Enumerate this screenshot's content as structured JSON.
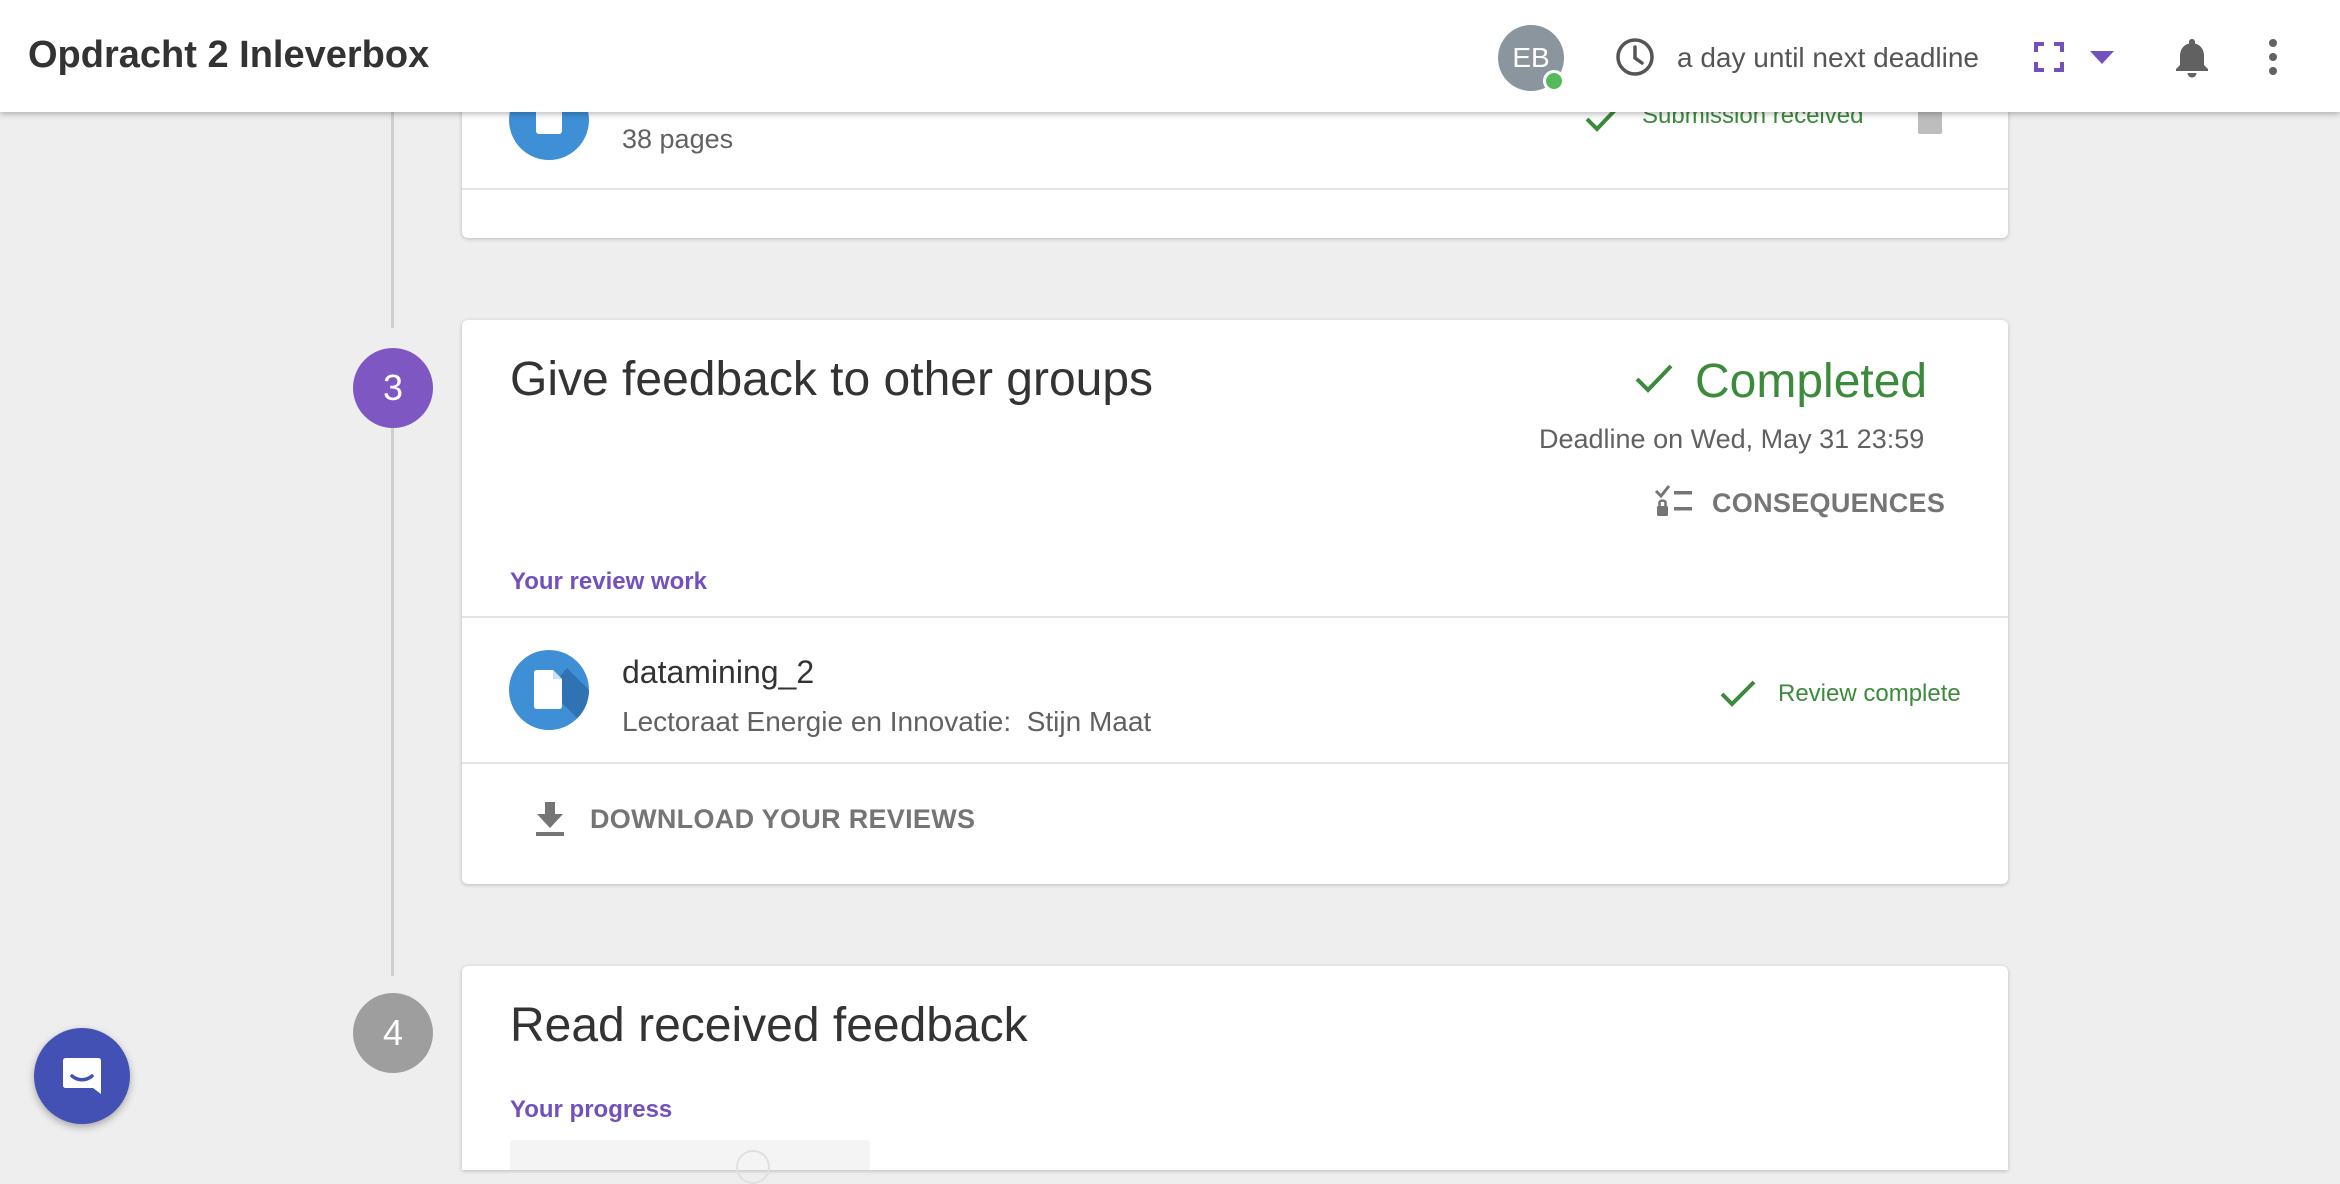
{
  "header": {
    "title": "Opdracht 2 Inleverbox",
    "avatar_initials": "EB",
    "deadline_text": "a day until next deadline",
    "accent_color": "#7251bd"
  },
  "step2_partial": {
    "pages": "38 pages",
    "status": "Submission received"
  },
  "step3": {
    "number": "3",
    "title": "Give feedback to other groups",
    "status": "Completed",
    "deadline": "Deadline on Wed, May 31 23:59",
    "consequences_label": "CONSEQUENCES",
    "section_label": "Your review work",
    "review": {
      "name": "datamining_2",
      "subtitle": "Lectoraat Energie en Innovatie:  Stijn Maat",
      "status": "Review complete"
    },
    "download_label": "DOWNLOAD YOUR REVIEWS"
  },
  "step4": {
    "number": "4",
    "title": "Read received feedback",
    "section_label": "Your progress"
  },
  "icons": [
    "clock-icon",
    "fullscreen-icon",
    "dropdown-icon",
    "bell-icon",
    "more-icon",
    "check-icon",
    "document-icon",
    "consequences-icon",
    "download-icon",
    "chat-icon"
  ],
  "colors": {
    "success": "#3c8a3c",
    "step_active": "#7e57c2",
    "step_inactive": "#9e9e9e",
    "file_icon": "#3f8fd7"
  }
}
